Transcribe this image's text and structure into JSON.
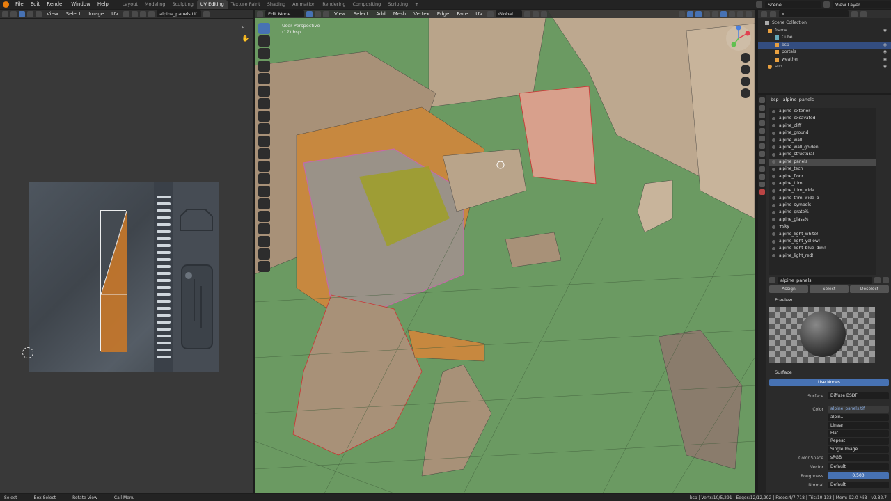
{
  "topbar": {
    "menus": [
      "File",
      "Edit",
      "Render",
      "Window",
      "Help"
    ],
    "workspaces": [
      "Layout",
      "Modeling",
      "Sculpting",
      "UV Editing",
      "Texture Paint",
      "Shading",
      "Animation",
      "Rendering",
      "Compositing",
      "Scripting"
    ],
    "active_workspace": "UV Editing",
    "scene": "Scene",
    "view_layer": "View Layer"
  },
  "uv_editor": {
    "menus": [
      "View",
      "Select",
      "Image",
      "UV"
    ],
    "image_name": "alpine_panels.tif"
  },
  "viewport": {
    "mode": "Edit Mode",
    "menus": [
      "View",
      "Select",
      "Add",
      "Mesh",
      "Vertex",
      "Edge",
      "Face",
      "UV"
    ],
    "orientation": "Global",
    "perspective": "User Perspective",
    "object_info": "(17) bsp"
  },
  "outliner": {
    "rows": [
      {
        "label": "Scene Collection",
        "indent": 0
      },
      {
        "label": "frame",
        "indent": 1
      },
      {
        "label": "Cube",
        "indent": 2
      },
      {
        "label": "bsp",
        "indent": 2,
        "selected": true
      },
      {
        "label": "portals",
        "indent": 2
      },
      {
        "label": "weather",
        "indent": 2
      },
      {
        "label": "sun",
        "indent": 1
      }
    ]
  },
  "properties": {
    "object": "bsp",
    "material": "alpine_panels",
    "slots": [
      "alpine_exterior",
      "alpine_excavated",
      "alpine_cliff",
      "alpine_ground",
      "alpine_wall",
      "alpine_wall_golden",
      "alpine_structural",
      "alpine_panels",
      "alpine_tech",
      "alpine_floor",
      "alpine_trim",
      "alpine_trim_wide",
      "alpine_trim_wide_b",
      "alpine_symbols",
      "alpine_grate%",
      "alpine_glass%",
      "+sky",
      "alpine_light_white!",
      "alpine_light_yellow!",
      "alpine_light_blue_dim!",
      "alpine_light_red!"
    ],
    "selected_slot": "alpine_panels",
    "material_field": "alpine_panels",
    "buttons": {
      "assign": "Assign",
      "select": "Select",
      "deselect": "Deselect"
    },
    "preview_label": "Preview",
    "surface_label": "Surface",
    "use_nodes": "Use Nodes",
    "surface": {
      "label": "Surface",
      "value": "Diffuse BSDF"
    },
    "color": {
      "label": "Color",
      "value": "alpine_panels.tif"
    },
    "image_short": "alpin...",
    "interp": "Linear",
    "projection": "Flat",
    "extension": "Repeat",
    "source": "Single Image",
    "colorspace": {
      "label": "Color Space",
      "value": "sRGB"
    },
    "vector": {
      "label": "Vector",
      "value": "Default"
    },
    "roughness": {
      "label": "Roughness",
      "value": "0.500"
    },
    "normal": {
      "label": "Normal",
      "value": "Default"
    }
  },
  "statusbar": {
    "select": "Select",
    "box_select": "Box Select",
    "rotate_view": "Rotate View",
    "call_menu": "Call Menu",
    "stats": "bsp | Verts:10/5,291 | Edges:12/12,992 | Faces:4/7,718 | Tris:10,133 | Mem: 92.0 MiB | v2.82.7"
  }
}
